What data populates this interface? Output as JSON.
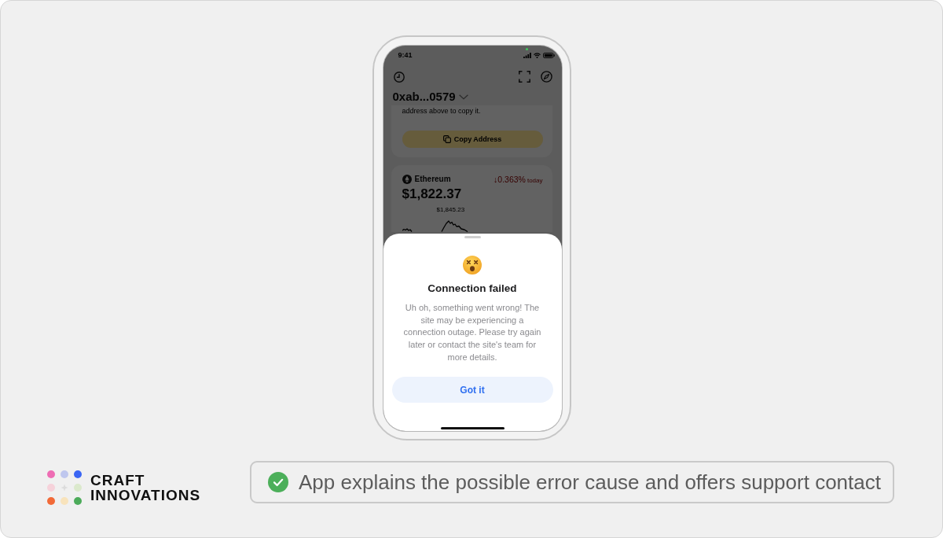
{
  "phone": {
    "status_bar": {
      "time": "9:41"
    },
    "wallet_header": {
      "address": "0xab...0579"
    },
    "address_card": {
      "hint": "address above to copy it.",
      "copy_button": "Copy Address"
    },
    "asset_card": {
      "name": "Ethereum",
      "change": "↓0.363%",
      "change_period": "today",
      "price": "$1,822.37",
      "peak_price": "$1,845.23"
    },
    "error_sheet": {
      "title": "Connection failed",
      "message": "Uh oh, something went wrong! The site may be experiencing a connection outage. Please try again later or contact the site's team for more details.",
      "button": "Got it"
    }
  },
  "brand": {
    "name": "CRAFT INNOVATIONS"
  },
  "caption": {
    "text": "App explains the possible error cause and offers support contact"
  }
}
